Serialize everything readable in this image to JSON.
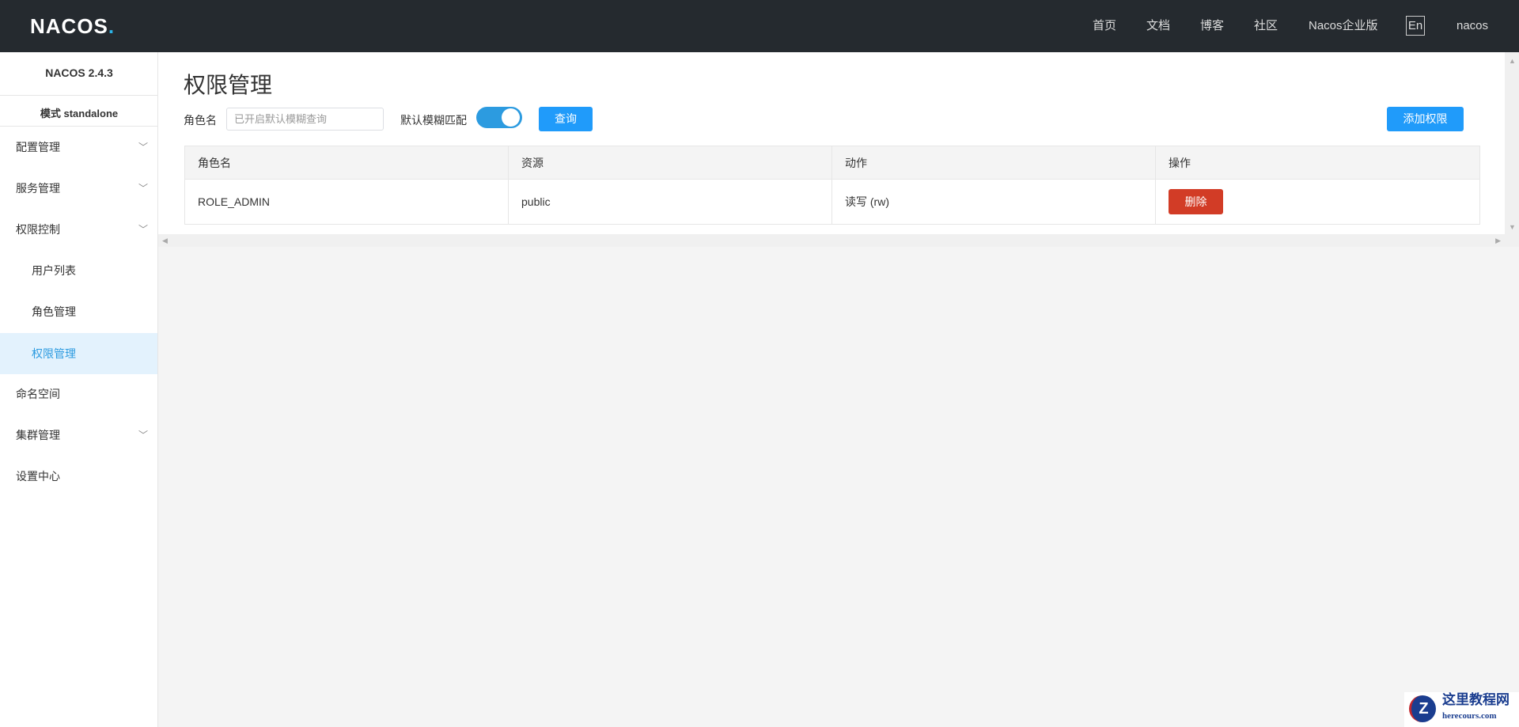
{
  "header": {
    "logo": "NACOS",
    "nav": [
      "首页",
      "文档",
      "博客",
      "社区",
      "Nacos企业版"
    ],
    "lang": "En",
    "user": "nacos"
  },
  "sidebar": {
    "version": "NACOS 2.4.3",
    "mode": "模式 standalone",
    "items": [
      {
        "label": "配置管理",
        "chevron": true
      },
      {
        "label": "服务管理",
        "chevron": true
      },
      {
        "label": "权限控制",
        "chevron": true
      },
      {
        "label": "用户列表"
      },
      {
        "label": "角色管理"
      },
      {
        "label": "权限管理",
        "active": true
      },
      {
        "label": "命名空间"
      },
      {
        "label": "集群管理",
        "chevron": true
      },
      {
        "label": "设置中心"
      }
    ]
  },
  "main": {
    "title": "权限管理",
    "role_label": "角色名",
    "role_placeholder": "已开启默认模糊查询",
    "fuzzy_label": "默认模糊匹配",
    "fuzzy_on": true,
    "query": "查询",
    "add": "添加权限",
    "columns": [
      "角色名",
      "资源",
      "动作",
      "操作"
    ],
    "rows": [
      {
        "role": "ROLE_ADMIN",
        "resource": "public",
        "action": "读写 (rw)",
        "op": "删除"
      }
    ]
  },
  "watermark": {
    "title": "这里教程网",
    "url": "herecours.com"
  },
  "colors": {
    "primary": "#209bfa",
    "danger": "#d23c26",
    "header": "#252a2f"
  }
}
